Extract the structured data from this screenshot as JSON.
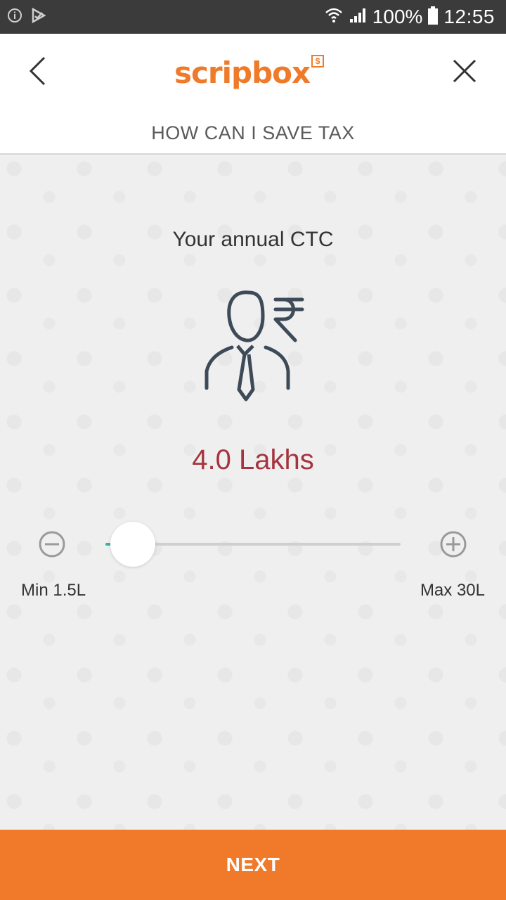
{
  "status_bar": {
    "battery_percent": "100%",
    "time": "12:55",
    "icons": [
      "info-icon",
      "play-icon",
      "wifi-icon",
      "signal-icon",
      "battery-icon"
    ]
  },
  "header": {
    "logo_text": "scripbox",
    "logo_badge": "$",
    "title": "HOW CAN I SAVE TAX",
    "icons": [
      "back-arrow-icon",
      "close-icon"
    ]
  },
  "question": {
    "label": "Your annual CTC",
    "icon": "person-rupee-icon",
    "value_text": "4.0 Lakhs"
  },
  "slider": {
    "min_label": "Min 1.5L",
    "max_label": "Max 30L",
    "min_value": 1.5,
    "max_value": 30,
    "current_value": 4.0,
    "minus_icon": "minus-circle-icon",
    "plus_icon": "plus-circle-icon"
  },
  "footer": {
    "next_label": "NEXT"
  },
  "colors": {
    "brand": "#ef7a2a",
    "value": "#a6343f",
    "slider_fill": "#3cb4a0"
  }
}
